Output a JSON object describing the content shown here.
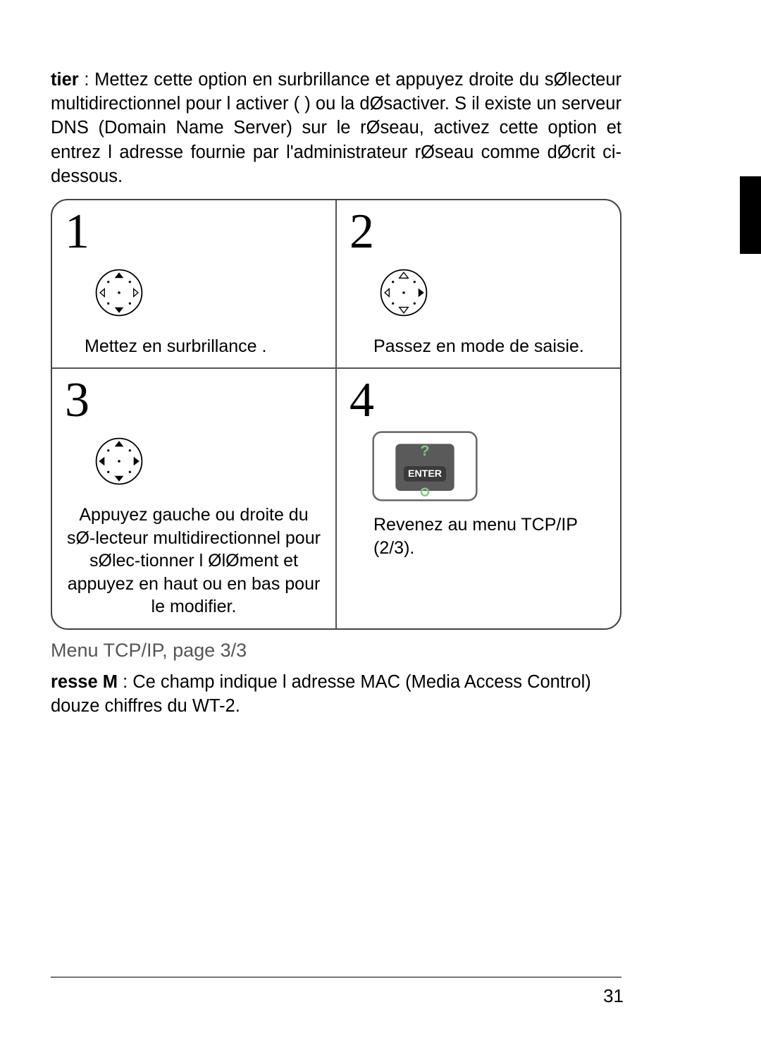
{
  "intro": {
    "bold_prefix": "tier",
    "text": ": Mettez cette option en surbrillance et appuyez  droite du sØlecteur multidirectionnel pour l activer ( ) ou la dØsactiver. S il existe un serveur DNS (Domain Name Server) sur le rØseau, activez cette option et entrez l adresse fournie par l'administrateur rØseau comme dØcrit ci-dessous."
  },
  "steps": [
    {
      "num": "1",
      "text": "Mettez en surbrillance                      ."
    },
    {
      "num": "2",
      "text": "Passez en mode de saisie."
    },
    {
      "num": "3",
      "text": "Appuyez  gauche ou  droite du sØ-lecteur multidirectionnel pour sØlec-tionner l ØlØment et appuyez en haut ou en bas pour le modiﬁer."
    },
    {
      "num": "4",
      "text": "Revenez au menu TCP/IP (2/3)."
    }
  ],
  "subhead": "Menu TCP/IP, page 3/3",
  "mac": {
    "bold_prefix": "resse M",
    "text": ": Ce champ indique l adresse MAC (Media Access Control)  douze chiffres du WT-2."
  },
  "enter_label": "ENTER",
  "page_number": "31"
}
